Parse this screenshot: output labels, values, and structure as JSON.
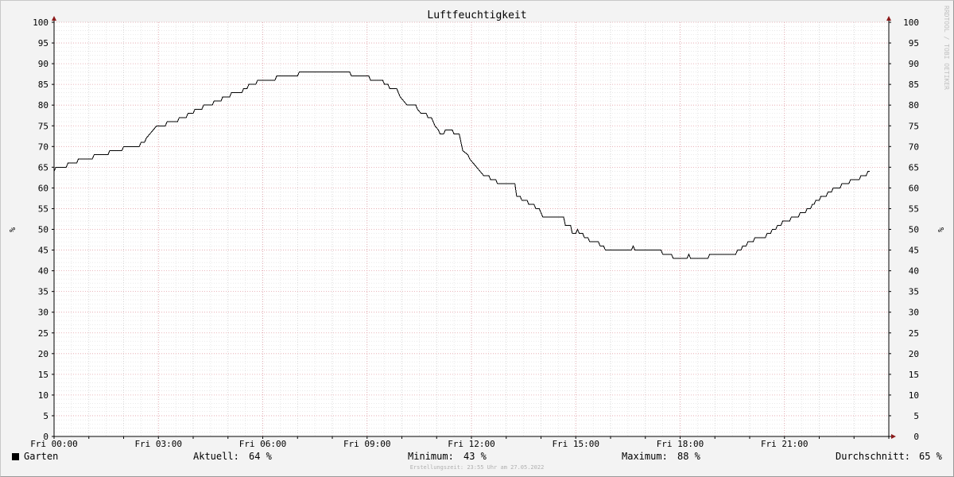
{
  "chart_data": {
    "type": "line",
    "title": "Luftfeuchtigkeit",
    "ylabel": "%",
    "ylim": [
      0,
      100
    ],
    "xlim_hours": [
      0,
      24
    ],
    "y_ticks": [
      0,
      5,
      10,
      15,
      20,
      25,
      30,
      35,
      40,
      45,
      50,
      55,
      60,
      65,
      70,
      75,
      80,
      85,
      90,
      95,
      100
    ],
    "x_ticks": [
      {
        "h": 0,
        "label": "Fri 00:00"
      },
      {
        "h": 3,
        "label": "Fri 03:00"
      },
      {
        "h": 6,
        "label": "Fri 06:00"
      },
      {
        "h": 9,
        "label": "Fri 09:00"
      },
      {
        "h": 12,
        "label": "Fri 12:00"
      },
      {
        "h": 15,
        "label": "Fri 15:00"
      },
      {
        "h": 18,
        "label": "Fri 18:00"
      },
      {
        "h": 21,
        "label": "Fri 21:00"
      }
    ],
    "grid": true,
    "series": [
      {
        "name": "Garten",
        "color": "#000000",
        "points": [
          [
            0.0,
            64
          ],
          [
            0.05,
            65
          ],
          [
            0.35,
            65
          ],
          [
            0.4,
            66
          ],
          [
            0.65,
            66
          ],
          [
            0.7,
            67
          ],
          [
            1.1,
            67
          ],
          [
            1.15,
            68
          ],
          [
            1.55,
            68
          ],
          [
            1.6,
            69
          ],
          [
            1.95,
            69
          ],
          [
            2.0,
            70
          ],
          [
            2.45,
            70
          ],
          [
            2.5,
            71
          ],
          [
            2.6,
            71
          ],
          [
            2.65,
            72
          ],
          [
            2.75,
            73
          ],
          [
            2.85,
            74
          ],
          [
            2.95,
            75
          ],
          [
            3.2,
            75
          ],
          [
            3.25,
            76
          ],
          [
            3.55,
            76
          ],
          [
            3.6,
            77
          ],
          [
            3.8,
            77
          ],
          [
            3.85,
            78
          ],
          [
            4.0,
            78
          ],
          [
            4.05,
            79
          ],
          [
            4.25,
            79
          ],
          [
            4.3,
            80
          ],
          [
            4.55,
            80
          ],
          [
            4.6,
            81
          ],
          [
            4.8,
            81
          ],
          [
            4.85,
            82
          ],
          [
            5.05,
            82
          ],
          [
            5.1,
            83
          ],
          [
            5.4,
            83
          ],
          [
            5.45,
            84
          ],
          [
            5.55,
            84
          ],
          [
            5.6,
            85
          ],
          [
            5.8,
            85
          ],
          [
            5.85,
            86
          ],
          [
            6.35,
            86
          ],
          [
            6.4,
            87
          ],
          [
            7.0,
            87
          ],
          [
            7.05,
            88
          ],
          [
            8.5,
            88
          ],
          [
            8.55,
            87
          ],
          [
            9.05,
            87
          ],
          [
            9.1,
            86
          ],
          [
            9.45,
            86
          ],
          [
            9.5,
            85
          ],
          [
            9.6,
            85
          ],
          [
            9.65,
            84
          ],
          [
            9.85,
            84
          ],
          [
            9.9,
            83
          ],
          [
            9.95,
            82
          ],
          [
            10.05,
            81
          ],
          [
            10.15,
            80
          ],
          [
            10.4,
            80
          ],
          [
            10.45,
            79
          ],
          [
            10.55,
            78
          ],
          [
            10.7,
            78
          ],
          [
            10.75,
            77
          ],
          [
            10.85,
            77
          ],
          [
            10.9,
            76
          ],
          [
            10.95,
            75
          ],
          [
            11.05,
            74
          ],
          [
            11.1,
            73
          ],
          [
            11.2,
            73
          ],
          [
            11.25,
            74
          ],
          [
            11.45,
            74
          ],
          [
            11.5,
            73
          ],
          [
            11.65,
            73
          ],
          [
            11.7,
            71
          ],
          [
            11.75,
            69
          ],
          [
            11.9,
            68
          ],
          [
            11.95,
            67
          ],
          [
            12.05,
            66
          ],
          [
            12.15,
            65
          ],
          [
            12.25,
            64
          ],
          [
            12.35,
            63
          ],
          [
            12.5,
            63
          ],
          [
            12.55,
            62
          ],
          [
            12.7,
            62
          ],
          [
            12.75,
            61
          ],
          [
            13.25,
            61
          ],
          [
            13.3,
            58
          ],
          [
            13.4,
            58
          ],
          [
            13.45,
            57
          ],
          [
            13.6,
            57
          ],
          [
            13.65,
            56
          ],
          [
            13.8,
            56
          ],
          [
            13.85,
            55
          ],
          [
            13.95,
            55
          ],
          [
            14.0,
            54
          ],
          [
            14.05,
            53
          ],
          [
            14.65,
            53
          ],
          [
            14.7,
            51
          ],
          [
            14.85,
            51
          ],
          [
            14.9,
            49
          ],
          [
            15.0,
            49
          ],
          [
            15.05,
            50
          ],
          [
            15.1,
            49
          ],
          [
            15.2,
            49
          ],
          [
            15.25,
            48
          ],
          [
            15.35,
            48
          ],
          [
            15.4,
            47
          ],
          [
            15.65,
            47
          ],
          [
            15.7,
            46
          ],
          [
            15.8,
            46
          ],
          [
            15.85,
            45
          ],
          [
            16.6,
            45
          ],
          [
            16.65,
            46
          ],
          [
            16.7,
            45
          ],
          [
            17.45,
            45
          ],
          [
            17.5,
            44
          ],
          [
            17.75,
            44
          ],
          [
            17.8,
            43
          ],
          [
            18.2,
            43
          ],
          [
            18.25,
            44
          ],
          [
            18.3,
            43
          ],
          [
            18.8,
            43
          ],
          [
            18.85,
            44
          ],
          [
            19.6,
            44
          ],
          [
            19.65,
            45
          ],
          [
            19.75,
            45
          ],
          [
            19.8,
            46
          ],
          [
            19.9,
            46
          ],
          [
            19.95,
            47
          ],
          [
            20.1,
            47
          ],
          [
            20.15,
            48
          ],
          [
            20.45,
            48
          ],
          [
            20.5,
            49
          ],
          [
            20.6,
            49
          ],
          [
            20.65,
            50
          ],
          [
            20.75,
            50
          ],
          [
            20.8,
            51
          ],
          [
            20.9,
            51
          ],
          [
            20.95,
            52
          ],
          [
            21.15,
            52
          ],
          [
            21.2,
            53
          ],
          [
            21.4,
            53
          ],
          [
            21.45,
            54
          ],
          [
            21.6,
            54
          ],
          [
            21.65,
            55
          ],
          [
            21.75,
            55
          ],
          [
            21.8,
            56
          ],
          [
            21.85,
            56
          ],
          [
            21.9,
            57
          ],
          [
            22.0,
            57
          ],
          [
            22.05,
            58
          ],
          [
            22.2,
            58
          ],
          [
            22.25,
            59
          ],
          [
            22.35,
            59
          ],
          [
            22.4,
            60
          ],
          [
            22.6,
            60
          ],
          [
            22.65,
            61
          ],
          [
            22.85,
            61
          ],
          [
            22.9,
            62
          ],
          [
            23.15,
            62
          ],
          [
            23.2,
            63
          ],
          [
            23.35,
            63
          ],
          [
            23.4,
            64
          ],
          [
            23.45,
            64
          ]
        ]
      }
    ]
  },
  "legend": {
    "series_name": "Garten",
    "current_label": "Aktuell:",
    "current_value": "64 %",
    "min_label": "Minimum:",
    "min_value": "43 %",
    "max_label": "Maximum:",
    "max_value": "88 %",
    "avg_label": "Durchschnitt:",
    "avg_value": "65 %"
  },
  "footer": "Erstellungszeit: 23:55 Uhr am 27.05.2022",
  "watermark": "RRDTOOL / TOBI OETIKER"
}
